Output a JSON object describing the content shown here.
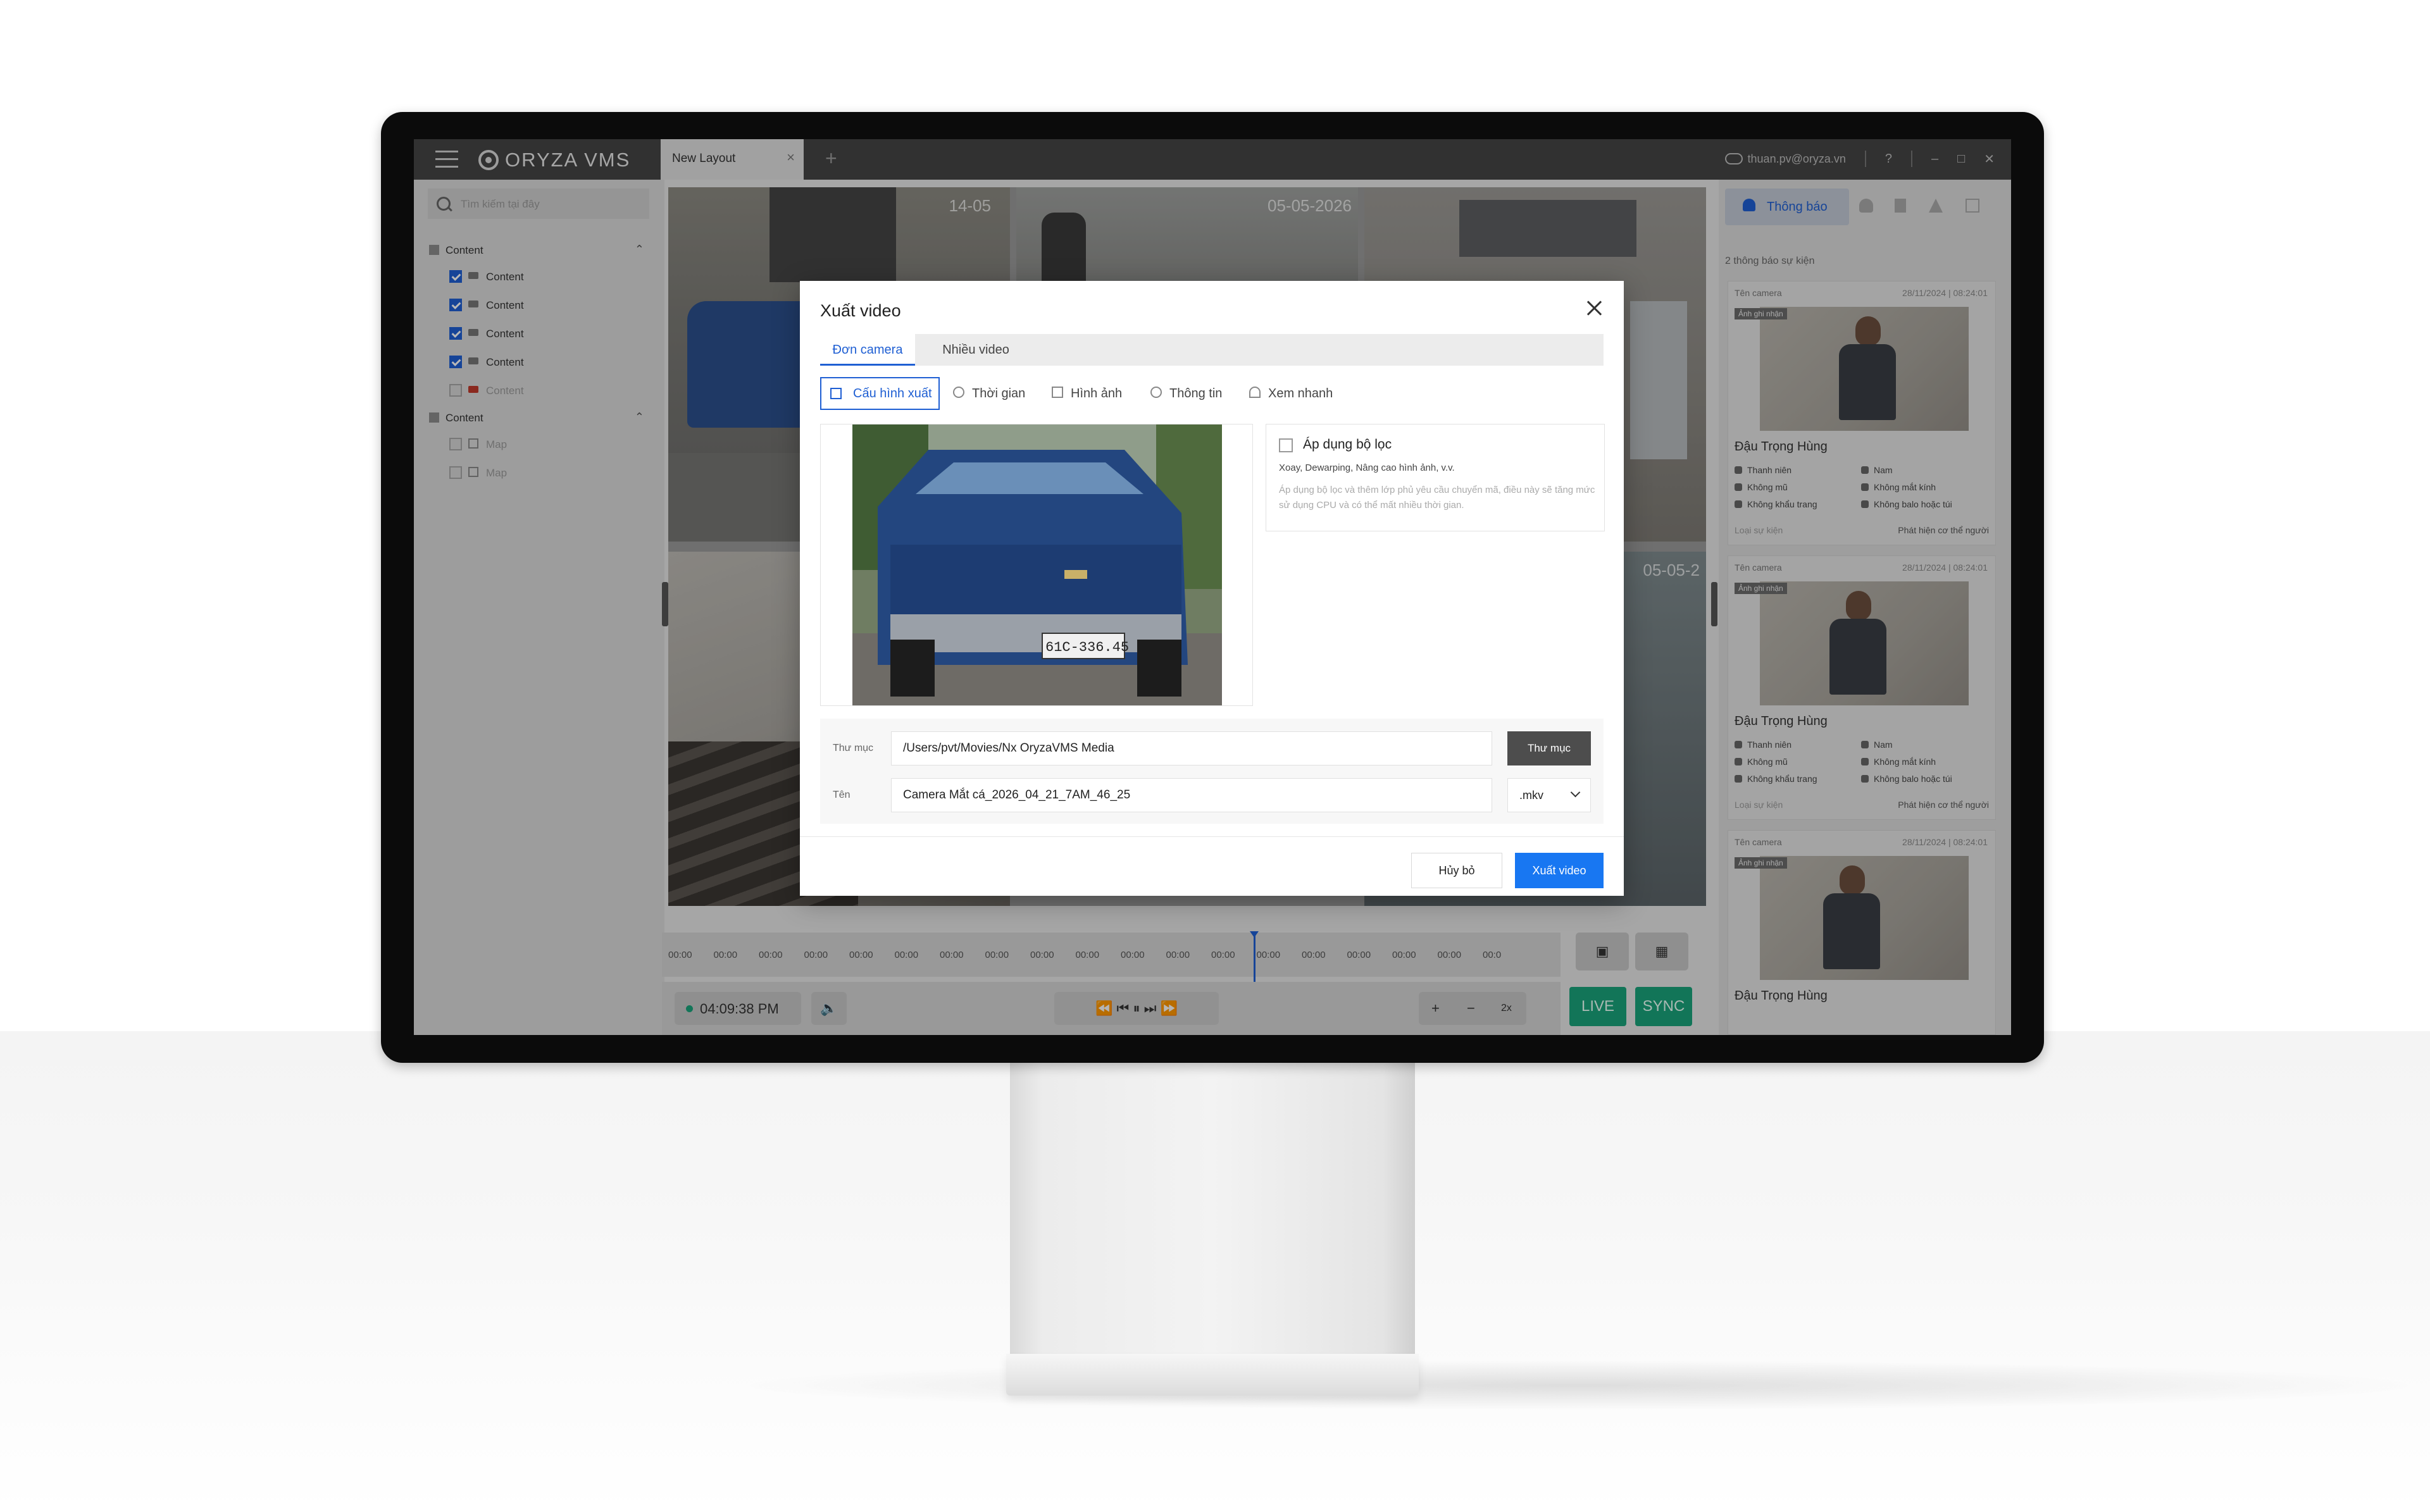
{
  "app": {
    "logo_text": "ORYZA VMS",
    "tab_label": "New Layout",
    "user_email": "thuan.pv@oryza.vn",
    "help": "?"
  },
  "sidebar": {
    "search_placeholder": "Tìm kiếm tại đây",
    "groups": [
      {
        "label": "Content",
        "items": [
          {
            "label": "Content",
            "checked": true
          },
          {
            "label": "Content",
            "checked": true
          },
          {
            "label": "Content",
            "checked": true
          },
          {
            "label": "Content",
            "checked": true
          },
          {
            "label": "Content",
            "checked": false
          }
        ]
      },
      {
        "label": "Content",
        "items": [
          {
            "label": "Map",
            "checked": false
          },
          {
            "label": "Map",
            "checked": false
          }
        ]
      }
    ]
  },
  "cameras": {
    "ts_1": "14-05",
    "ts_2": "05-05-2026",
    "ts_3": "05-05-2"
  },
  "timeline": {
    "ticks": [
      "00:00",
      "00:00",
      "00:00",
      "00:00",
      "00:00",
      "00:00",
      "00:00",
      "00:00",
      "00:00",
      "00:00",
      "00:00",
      "00:00",
      "00:00",
      "00:00",
      "00:00",
      "00:00",
      "00:00",
      "00:00",
      "00:0"
    ]
  },
  "controls": {
    "time": "04:09:38 PM",
    "plus": "+",
    "minus": "−",
    "speed": "2x",
    "live": "LIVE",
    "sync": "SYNC"
  },
  "notifications": {
    "tab_label": "Thông báo",
    "count_text": "2 thông báo sự kiện",
    "events": [
      {
        "camera_label": "Tên camera",
        "date": "28/11/2024",
        "time": "08:24:01",
        "tag": "Ảnh ghi nhận",
        "name": "Đậu Trọng Hùng",
        "attrs": [
          "Thanh niên",
          "Nam",
          "Không mũ",
          "Không mắt kính",
          "Không khẩu trang",
          "Không balo hoặc túi"
        ],
        "event_type_label": "Loại sự kiện",
        "event_type": "Phát hiện cơ thể người"
      },
      {
        "camera_label": "Tên camera",
        "date": "28/11/2024",
        "time": "08:24:01",
        "tag": "Ảnh ghi nhận",
        "name": "Đậu Trọng Hùng",
        "attrs": [
          "Thanh niên",
          "Nam",
          "Không mũ",
          "Không mắt kính",
          "Không khẩu trang",
          "Không balo hoặc túi"
        ],
        "event_type_label": "Loại sự kiện",
        "event_type": "Phát hiện cơ thể người"
      },
      {
        "camera_label": "Tên camera",
        "date": "28/11/2024",
        "time": "08:24:01",
        "tag": "Ảnh ghi nhận",
        "name": "Đậu Trọng Hùng"
      }
    ]
  },
  "dialog": {
    "title": "Xuất video",
    "tabs": [
      "Đơn camera",
      "Nhiều video"
    ],
    "subtabs": [
      "Cấu hình xuất",
      "Thời gian",
      "Hình ảnh",
      "Thông tin",
      "Xem nhanh"
    ],
    "preview_plate": "61C-336.45",
    "filter": {
      "title": "Áp dụng bộ lọc",
      "subtitle": "Xoay, Dewarping, Nâng cao hình ảnh, v.v.",
      "description": "Áp dụng bộ lọc và thêm lớp phủ yêu cầu chuyển mã, điều này sẽ tăng mức sử dụng CPU và có thể mất nhiều thời gian."
    },
    "folder_label": "Thư mục",
    "folder_value": "/Users/pvt/Movies/Nx OryzaVMS Media",
    "folder_button": "Thư mục",
    "name_label": "Tên",
    "name_value": "Camera Mắt cá_2026_04_21_7AM_46_25",
    "extension": ".mkv",
    "cancel": "Hủy bỏ",
    "export": "Xuất video"
  },
  "colors": {
    "accent": "#1f5fd3",
    "primary_button": "#1877f2",
    "live_green": "#1aa37a"
  }
}
